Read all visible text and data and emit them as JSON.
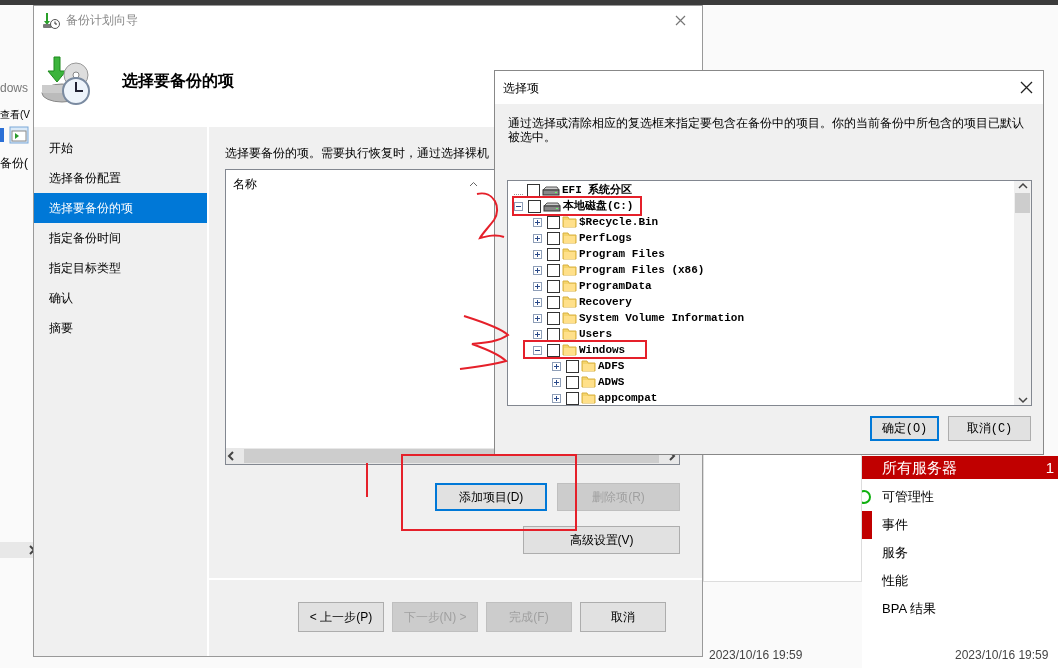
{
  "background_window": {
    "title_fragment": "dows",
    "menu_fragment": "查看(V",
    "tree_fragment": "备份(",
    "tile": {
      "title": "所有服务器",
      "count": "1",
      "items": [
        {
          "label": "可管理性",
          "kind": "ring",
          "color": "#10b010"
        },
        {
          "label": "事件",
          "kind": "bar",
          "color": "#c00000"
        },
        {
          "label": "服务",
          "kind": "plain"
        },
        {
          "label": "性能",
          "kind": "plain"
        },
        {
          "label": "BPA 结果",
          "kind": "plain"
        }
      ]
    },
    "timestamps": [
      "2023/10/16 19:59",
      "2023/10/16 19:59"
    ]
  },
  "wizard": {
    "title": "备份计划向导",
    "heading": "选择要备份的项",
    "steps": [
      {
        "label": "开始",
        "selected": false
      },
      {
        "label": "选择备份配置",
        "selected": false
      },
      {
        "label": "选择要备份的项",
        "selected": true
      },
      {
        "label": "指定备份时间",
        "selected": false
      },
      {
        "label": "指定目标类型",
        "selected": false
      },
      {
        "label": "确认",
        "selected": false
      },
      {
        "label": "摘要",
        "selected": false
      }
    ],
    "description": "选择要备份的项。需要执行恢复时，通过选择裸机",
    "list_column": "名称",
    "item_buttons": [
      {
        "label": "添加项目(D)",
        "disabled": false,
        "focused": true
      },
      {
        "label": "删除项(R)",
        "disabled": true,
        "focused": false
      }
    ],
    "advanced_button": {
      "label": "高级设置(V)",
      "disabled": false
    },
    "footer_buttons": [
      {
        "label": "< 上一步(P)",
        "disabled": false
      },
      {
        "label": "下一步(N) >",
        "disabled": true
      },
      {
        "label": "完成(F)",
        "disabled": true
      },
      {
        "label": "取消",
        "disabled": false
      }
    ]
  },
  "dialog": {
    "title": "选择项",
    "description": "通过选择或清除相应的复选框来指定要包含在备份中的项目。你的当前备份中所包含的项目已默认被选中。",
    "tree": [
      {
        "label": "EFI 系统分区",
        "kind": "drive",
        "has_children": false,
        "checked": false
      },
      {
        "label": "本地磁盘(C:)",
        "kind": "drive",
        "has_children": true,
        "expanded": true,
        "checked": false,
        "children": [
          {
            "label": "$Recycle.Bin",
            "kind": "folder",
            "has_children": true,
            "expanded": false,
            "checked": false
          },
          {
            "label": "PerfLogs",
            "kind": "folder",
            "has_children": true,
            "expanded": false,
            "checked": false
          },
          {
            "label": "Program Files",
            "kind": "folder",
            "has_children": true,
            "expanded": false,
            "checked": false
          },
          {
            "label": "Program Files (x86)",
            "kind": "folder",
            "has_children": true,
            "expanded": false,
            "checked": false
          },
          {
            "label": "ProgramData",
            "kind": "folder",
            "has_children": true,
            "expanded": false,
            "checked": false
          },
          {
            "label": "Recovery",
            "kind": "folder",
            "has_children": true,
            "expanded": false,
            "checked": false
          },
          {
            "label": "System Volume Information",
            "kind": "folder",
            "has_children": true,
            "expanded": false,
            "checked": false
          },
          {
            "label": "Users",
            "kind": "folder",
            "has_children": true,
            "expanded": false,
            "checked": false
          },
          {
            "label": "Windows",
            "kind": "folder",
            "has_children": true,
            "expanded": true,
            "checked": false,
            "children": [
              {
                "label": "ADFS",
                "kind": "folder",
                "has_children": true,
                "expanded": false,
                "checked": false
              },
              {
                "label": "ADWS",
                "kind": "folder",
                "has_children": true,
                "expanded": false,
                "checked": false
              },
              {
                "label": "appcompat",
                "kind": "folder",
                "has_children": true,
                "expanded": false,
                "checked": false
              }
            ]
          }
        ]
      }
    ],
    "buttons": [
      {
        "label": "确定(O)",
        "focused": true
      },
      {
        "label": "取消(C)",
        "focused": false
      }
    ]
  }
}
